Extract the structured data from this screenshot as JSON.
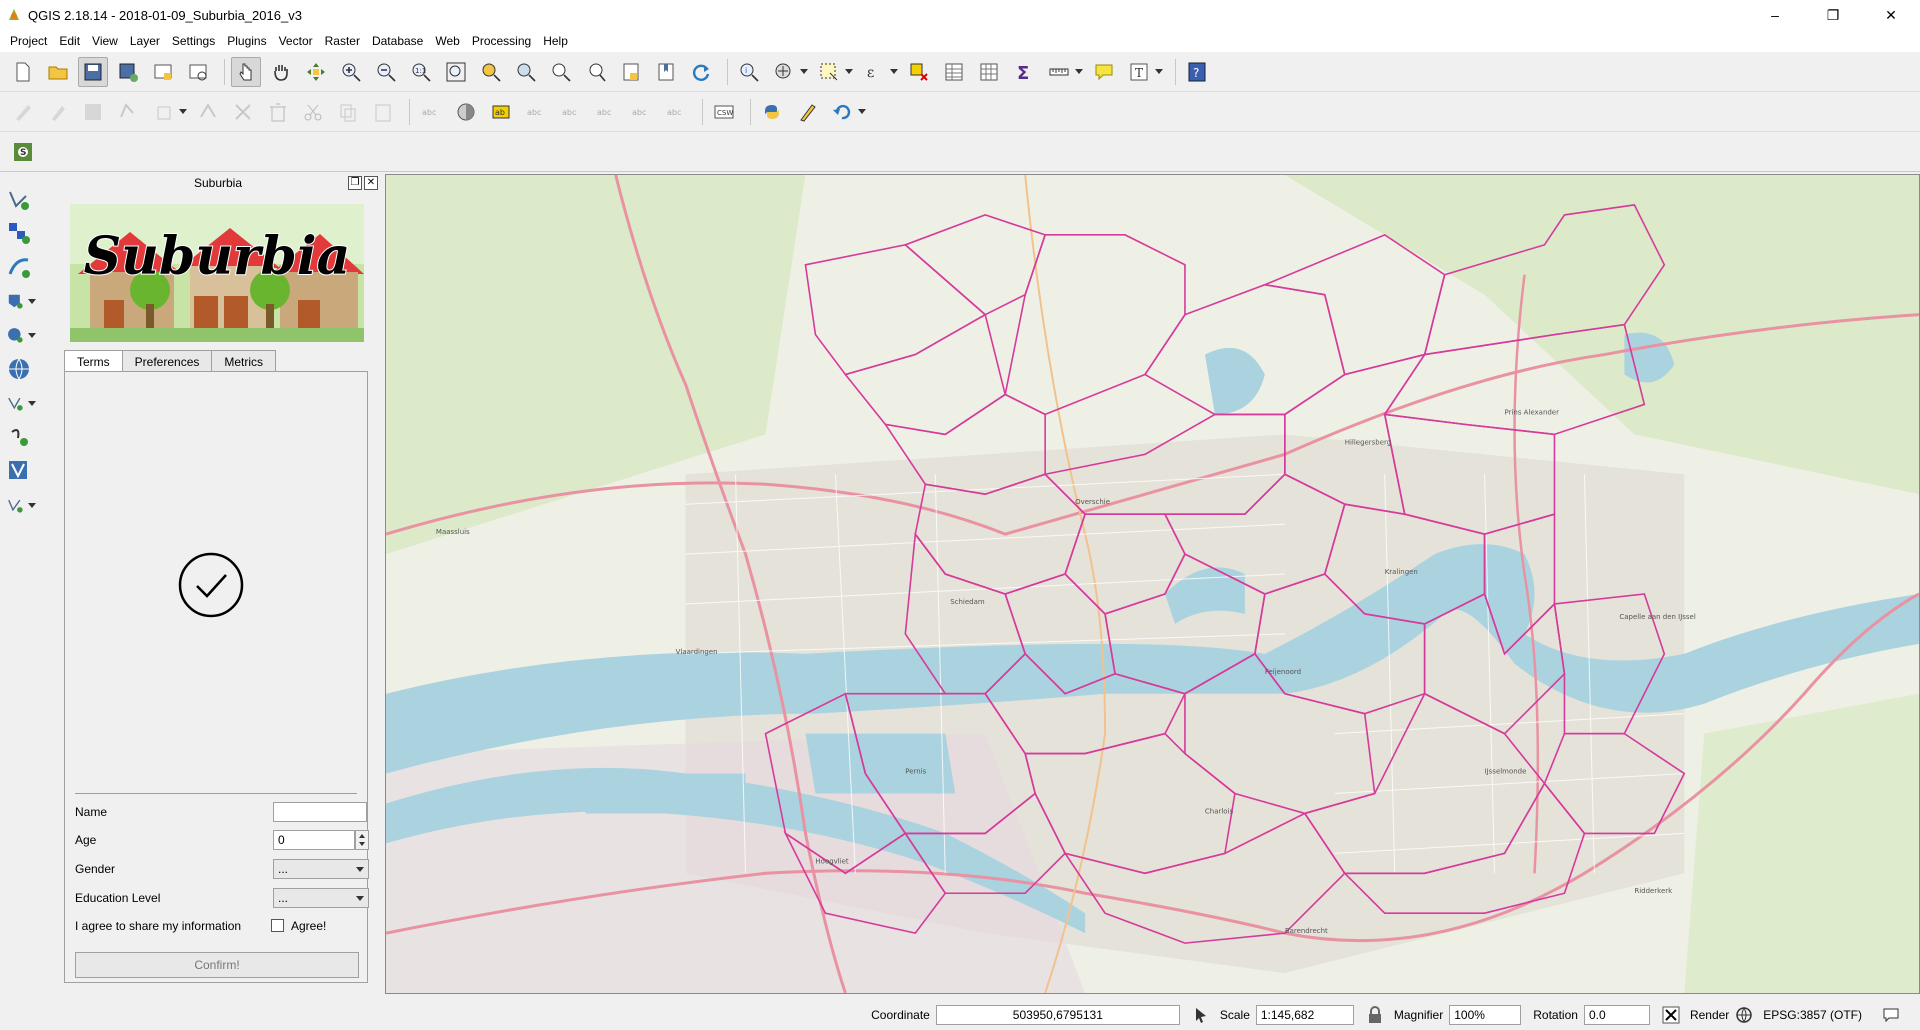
{
  "window": {
    "title": "QGIS 2.18.14 - 2018-01-09_Suburbia_2016_v3",
    "minimize": "–",
    "restore": "❐",
    "close": "✕"
  },
  "menu": [
    "Project",
    "Edit",
    "View",
    "Layer",
    "Settings",
    "Plugins",
    "Vector",
    "Raster",
    "Database",
    "Web",
    "Processing",
    "Help"
  ],
  "dock": {
    "title": "Suburbia",
    "logo_text": "Suburbia",
    "tabs": [
      "Terms",
      "Preferences",
      "Metrics"
    ],
    "active_tab": "Terms",
    "form": {
      "name_label": "Name",
      "name_value": "",
      "age_label": "Age",
      "age_value": "0",
      "gender_label": "Gender",
      "gender_value": "...",
      "education_label": "Education Level",
      "education_value": "...",
      "agree_label": "I agree to share my information",
      "agree_checkbox_label": "Agree!",
      "agree_checked": false,
      "confirm_label": "Confirm!"
    }
  },
  "status": {
    "coordinate_label": "Coordinate",
    "coordinate_value": "503950,6795131",
    "scale_label": "Scale",
    "scale_value": "1:145,682",
    "magnifier_label": "Magnifier",
    "magnifier_value": "100%",
    "rotation_label": "Rotation",
    "rotation_value": "0.0",
    "render_label": "Render",
    "render_checked": true,
    "crs_label": "EPSG:3857 (OTF)"
  },
  "colors": {
    "district_lines": "#d63a9b",
    "river": "#aad3df",
    "land": "#eef0e6",
    "green": "#cfe6b4",
    "urban": "#e2dfd8",
    "major_road": "#e892a2"
  },
  "map": {
    "place_labels": [
      "Maassluis",
      "Vlaardingen",
      "Schiedam",
      "Capelle aan den IJssel",
      "Barendrecht",
      "Ridderkerk",
      "Hoogvliet",
      "Pernis",
      "Kralingen",
      "Overschie",
      "Feijenoord",
      "IJsselmonde",
      "Charlois",
      "Hillegersberg",
      "Prins Alexander"
    ]
  }
}
